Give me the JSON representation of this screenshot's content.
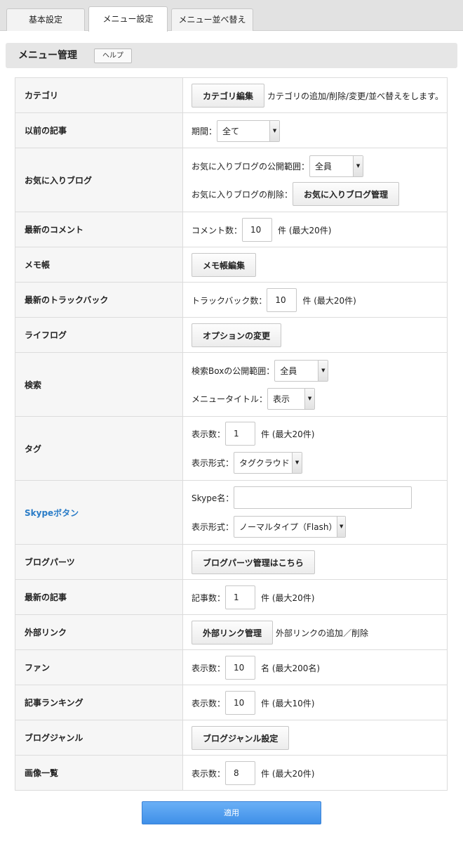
{
  "tabs": [
    "基本設定",
    "メニュー設定",
    "メニュー並べ替え"
  ],
  "header": {
    "title": "メニュー管理",
    "help": "ヘルプ"
  },
  "arrow_glyph": "▼",
  "rows": [
    {
      "label": "カテゴリ",
      "button": "カテゴリ編集",
      "note": "カテゴリの追加/削除/変更/並べ替えをします。"
    },
    {
      "label": "以前の記事",
      "period_label": "期間：",
      "period_value": "全て"
    },
    {
      "label": "お気に入りブログ",
      "scope_label": "お気に入りブログの公開範囲：",
      "scope_value": "全員",
      "delete_label": "お気に入りブログの削除：",
      "manage_button": "お気に入りブログ管理"
    },
    {
      "label": "最新のコメント",
      "count_label": "コメント数：",
      "count_value": "10",
      "unit": "件 (最大20件)"
    },
    {
      "label": "メモ帳",
      "button": "メモ帳編集"
    },
    {
      "label": "最新のトラックバック",
      "count_label": "トラックバック数：",
      "count_value": "10",
      "unit": "件 (最大20件)"
    },
    {
      "label": "ライフログ",
      "button": "オプションの変更"
    },
    {
      "label": "検索",
      "scope_label": "検索Boxの公開範囲：",
      "scope_value": "全員",
      "title_label": "メニュータイトル：",
      "title_value": "表示"
    },
    {
      "label": "タグ",
      "count_label": "表示数：",
      "count_value": "1",
      "unit": "件 (最大20件)",
      "format_label": "表示形式：",
      "format_value": "タグクラウド"
    },
    {
      "label": "Skypeボタン",
      "name_label": "Skype名：",
      "name_value": "",
      "format_label": "表示形式：",
      "format_value": "ノーマルタイプ（Flash）"
    },
    {
      "label": "ブログパーツ",
      "button": "ブログパーツ管理はこちら"
    },
    {
      "label": "最新の記事",
      "count_label": "記事数：",
      "count_value": "1",
      "unit": "件 (最大20件)"
    },
    {
      "label": "外部リンク",
      "button": "外部リンク管理",
      "note": "外部リンクの追加／削除"
    },
    {
      "label": "ファン",
      "count_label": "表示数：",
      "count_value": "10",
      "unit": "名 (最大200名)"
    },
    {
      "label": "記事ランキング",
      "count_label": "表示数：",
      "count_value": "10",
      "unit": "件 (最大10件)"
    },
    {
      "label": "ブログジャンル",
      "button": "ブログジャンル設定"
    },
    {
      "label": "画像一覧",
      "count_label": "表示数：",
      "count_value": "8",
      "unit": "件 (最大20件)"
    }
  ],
  "apply": "適用"
}
